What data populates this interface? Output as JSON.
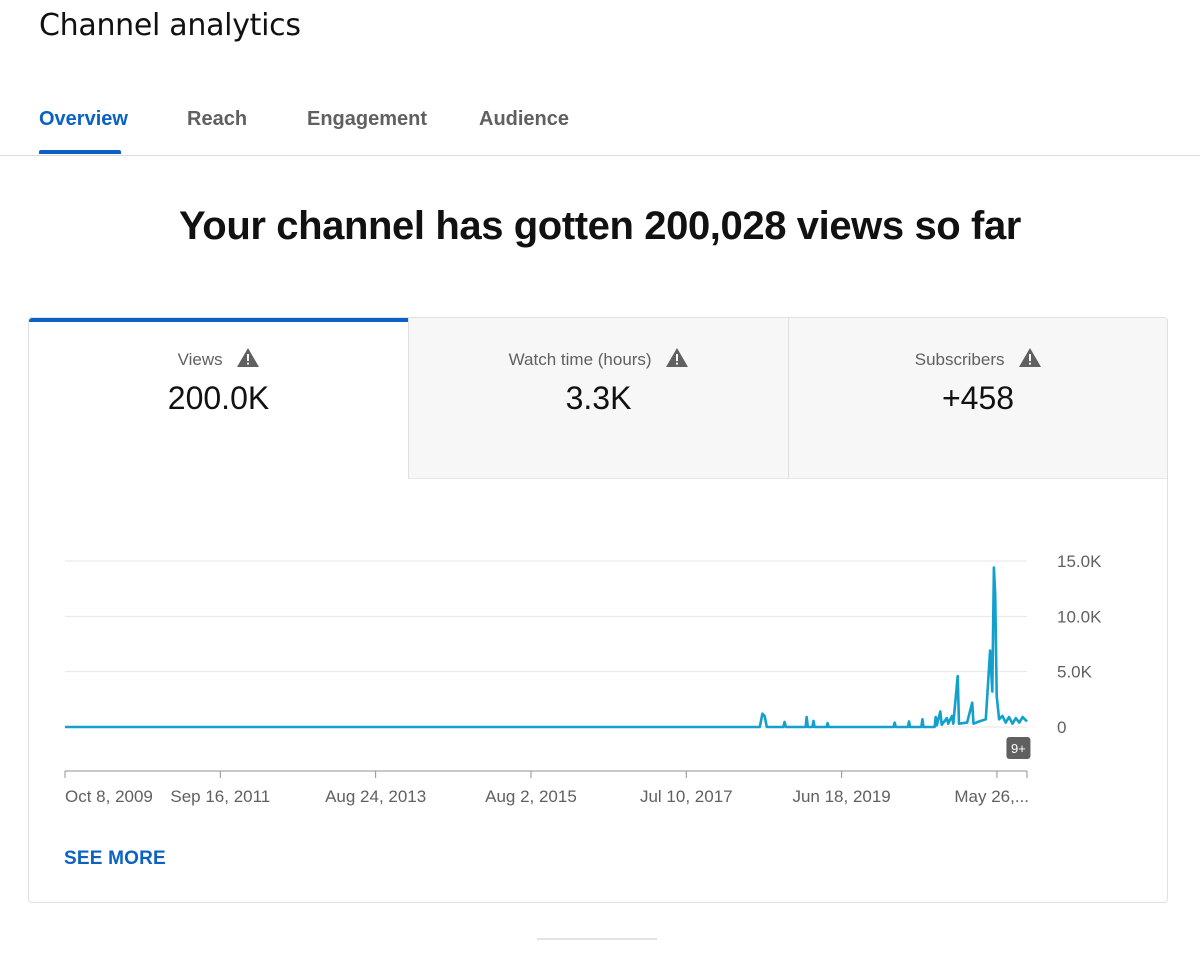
{
  "page": {
    "title": "Channel analytics"
  },
  "tabs": [
    {
      "label": "Overview",
      "active": true
    },
    {
      "label": "Reach",
      "active": false
    },
    {
      "label": "Engagement",
      "active": false
    },
    {
      "label": "Audience",
      "active": false
    }
  ],
  "headline": "Your channel has gotten 200,028 views so far",
  "metrics": [
    {
      "label": "Views",
      "value": "200.0K",
      "selected": true,
      "icon": "warning-icon"
    },
    {
      "label": "Watch time (hours)",
      "value": "3.3K",
      "selected": false,
      "icon": "warning-icon"
    },
    {
      "label": "Subscribers",
      "value": "+458",
      "selected": false,
      "icon": "warning-icon"
    }
  ],
  "see_more_label": "SEE MORE",
  "colors": {
    "accent": "#0b61c4",
    "line": "#13a0cc",
    "badge": "#606060"
  },
  "chart_data": {
    "type": "line",
    "title": "",
    "xlabel": "",
    "ylabel": "",
    "ylim": [
      0,
      15000
    ],
    "yticks": [
      {
        "value": 15000,
        "label": "15.0K"
      },
      {
        "value": 10000,
        "label": "10.0K"
      },
      {
        "value": 5000,
        "label": "5.0K"
      },
      {
        "value": 0,
        "label": "0"
      }
    ],
    "xticks": [
      {
        "x": "2009-10-08",
        "label": "Oct 8, 2009"
      },
      {
        "x": "2011-09-16",
        "label": "Sep 16, 2011"
      },
      {
        "x": "2013-08-24",
        "label": "Aug 24, 2013"
      },
      {
        "x": "2015-08-02",
        "label": "Aug 2, 2015"
      },
      {
        "x": "2017-07-10",
        "label": "Jul 10, 2017"
      },
      {
        "x": "2019-06-18",
        "label": "Jun 18, 2019"
      },
      {
        "x": "2021-05-26",
        "label": "May 26,..."
      }
    ],
    "xlim": [
      "2009-10-08",
      "2021-10-10"
    ],
    "grid": true,
    "badge": {
      "x": "2021-09-01",
      "label": "9+"
    },
    "series": [
      {
        "name": "",
        "points": [
          [
            "2009-10-08",
            0
          ],
          [
            "2018-06-10",
            0
          ],
          [
            "2018-06-22",
            1200
          ],
          [
            "2018-07-02",
            1000
          ],
          [
            "2018-07-12",
            0
          ],
          [
            "2018-09-25",
            0
          ],
          [
            "2018-10-01",
            450
          ],
          [
            "2018-10-07",
            0
          ],
          [
            "2019-01-05",
            0
          ],
          [
            "2019-01-10",
            900
          ],
          [
            "2019-01-15",
            0
          ],
          [
            "2019-02-05",
            0
          ],
          [
            "2019-02-10",
            550
          ],
          [
            "2019-02-15",
            0
          ],
          [
            "2019-04-10",
            0
          ],
          [
            "2019-04-15",
            350
          ],
          [
            "2019-04-20",
            0
          ],
          [
            "2020-02-10",
            0
          ],
          [
            "2020-02-15",
            400
          ],
          [
            "2020-02-20",
            0
          ],
          [
            "2020-04-15",
            0
          ],
          [
            "2020-04-20",
            500
          ],
          [
            "2020-04-25",
            0
          ],
          [
            "2020-06-15",
            0
          ],
          [
            "2020-06-20",
            700
          ],
          [
            "2020-06-25",
            0
          ],
          [
            "2020-08-15",
            0
          ],
          [
            "2020-08-20",
            900
          ],
          [
            "2020-08-25",
            150
          ],
          [
            "2020-09-10",
            1400
          ],
          [
            "2020-09-16",
            200
          ],
          [
            "2020-10-10",
            800
          ],
          [
            "2020-10-16",
            300
          ],
          [
            "2020-11-02",
            1000
          ],
          [
            "2020-11-08",
            300
          ],
          [
            "2020-11-28",
            4600
          ],
          [
            "2020-12-04",
            300
          ],
          [
            "2021-01-10",
            400
          ],
          [
            "2021-02-02",
            2200
          ],
          [
            "2021-02-08",
            300
          ],
          [
            "2021-03-05",
            500
          ],
          [
            "2021-04-05",
            700
          ],
          [
            "2021-04-25",
            6900
          ],
          [
            "2021-05-05",
            3200
          ],
          [
            "2021-05-12",
            14400
          ],
          [
            "2021-05-18",
            12000
          ],
          [
            "2021-05-25",
            2800
          ],
          [
            "2021-06-05",
            700
          ],
          [
            "2021-06-20",
            1000
          ],
          [
            "2021-07-05",
            400
          ],
          [
            "2021-07-20",
            900
          ],
          [
            "2021-08-05",
            300
          ],
          [
            "2021-08-20",
            800
          ],
          [
            "2021-09-05",
            400
          ],
          [
            "2021-09-20",
            900
          ],
          [
            "2021-10-10",
            500
          ]
        ]
      }
    ]
  }
}
